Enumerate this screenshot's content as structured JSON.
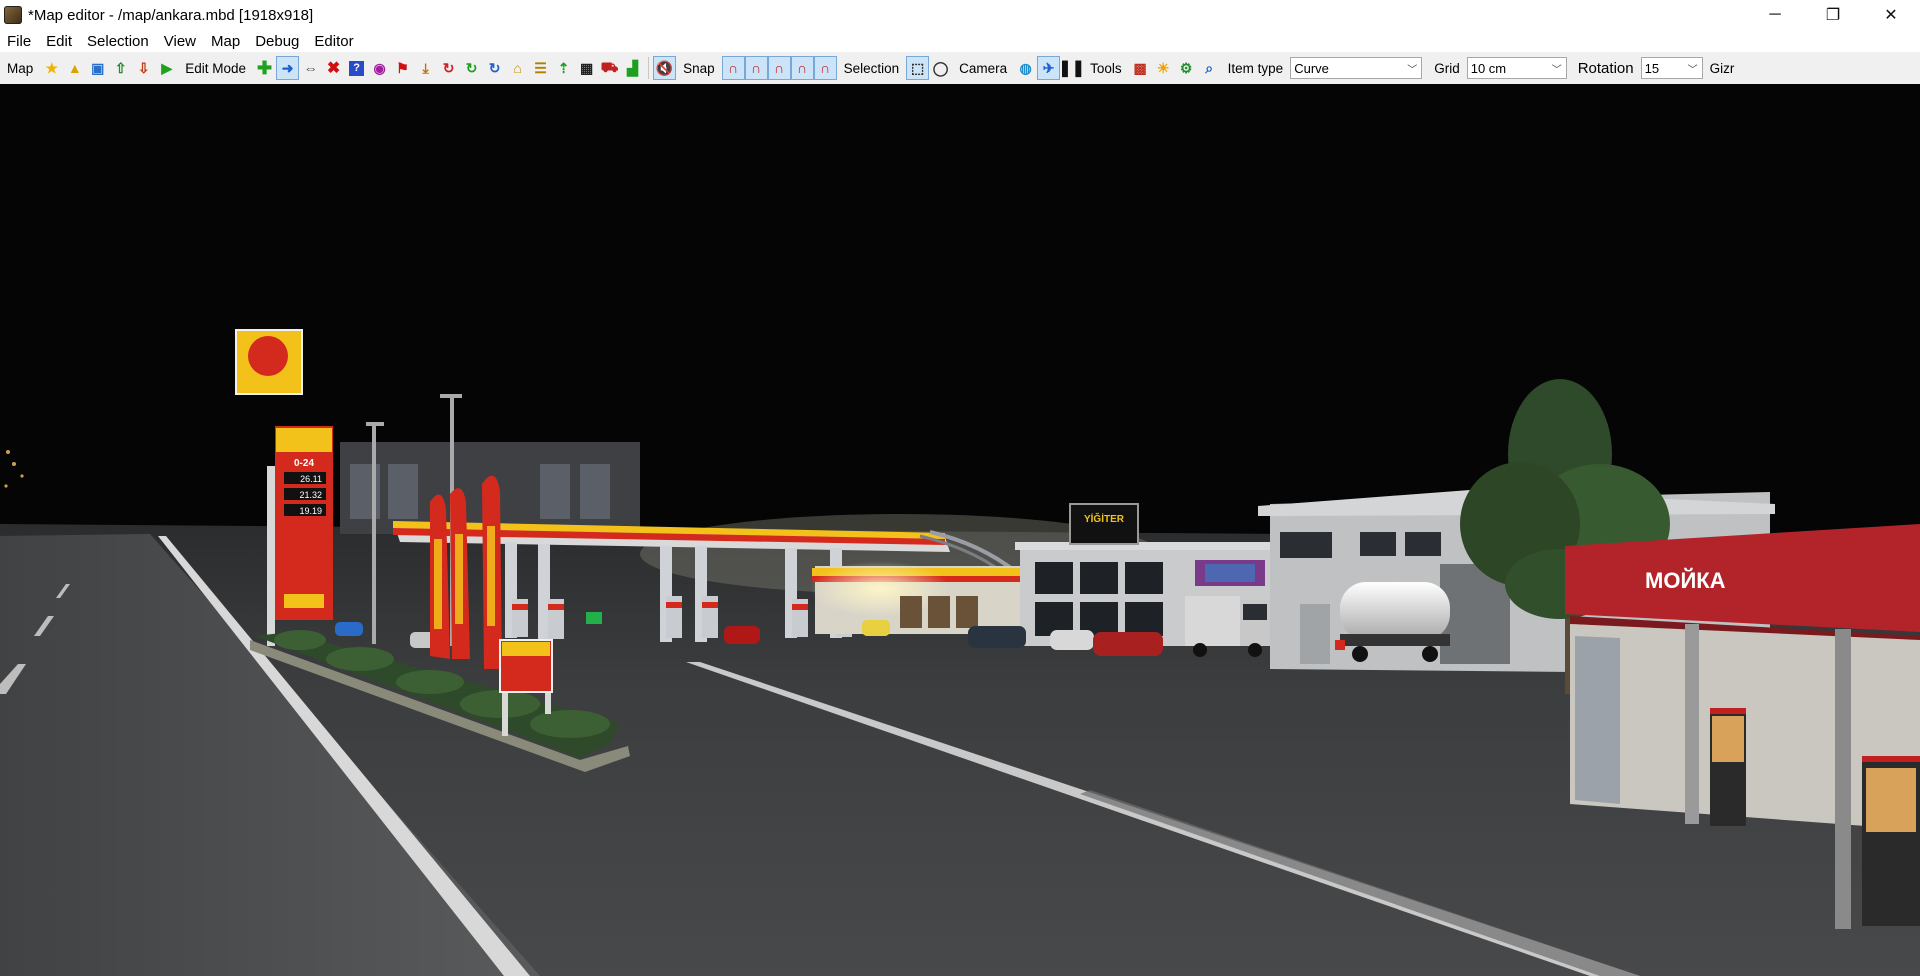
{
  "window": {
    "title": "*Map editor - /map/ankara.mbd [1918x918]",
    "controls": {
      "minimize": "─",
      "restore": "❐",
      "close": "✕"
    }
  },
  "menu": [
    "File",
    "Edit",
    "Selection",
    "View",
    "Map",
    "Debug",
    "Editor"
  ],
  "toolbar": {
    "map_label": "Map",
    "edit_mode_label": "Edit Mode",
    "snap_label": "Snap",
    "selection_label": "Selection",
    "camera_label": "Camera",
    "tools_label": "Tools",
    "item_type_label": "Item type",
    "item_type_value": "Curve",
    "grid_label": "Grid",
    "grid_value": "10 cm",
    "rotation_label": "Rotation",
    "rotation_value": "15",
    "gizmo_label": "Gizr"
  },
  "scene": {
    "pole_sign_price_header": "0-24",
    "pole_sign_prices": [
      "26.11",
      "21.32",
      "19.19"
    ],
    "billboard_text": "YİĞİTER",
    "wash_text": "МОЙКА",
    "colors": {
      "sky": "#050505",
      "asphalt": "#3a3c3e",
      "canopy_red": "#d42a1e",
      "canopy_yellow": "#f3c21a",
      "wash_red": "#b3242a"
    }
  }
}
